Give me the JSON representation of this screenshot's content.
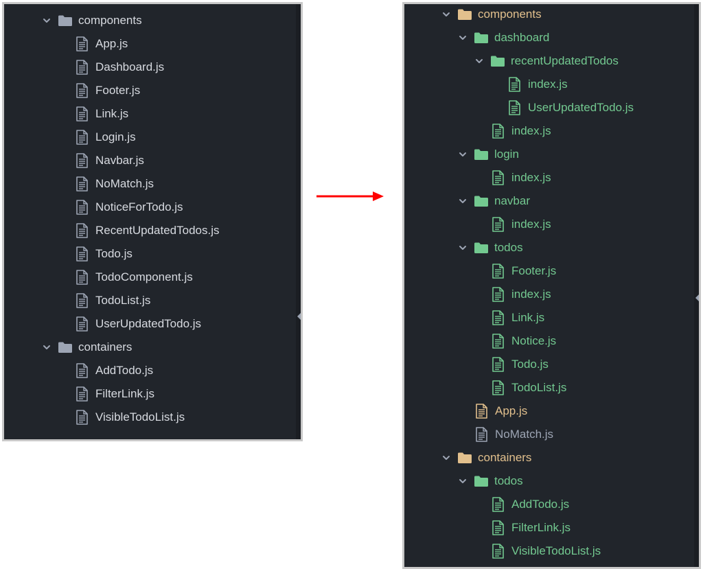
{
  "left_tree": {
    "rows": [
      {
        "label": "components",
        "kind": "folder",
        "expanded": true,
        "depth": 0,
        "color": "white"
      },
      {
        "label": "App.js",
        "kind": "file",
        "depth": 1,
        "color": "white"
      },
      {
        "label": "Dashboard.js",
        "kind": "file",
        "depth": 1,
        "color": "white"
      },
      {
        "label": "Footer.js",
        "kind": "file",
        "depth": 1,
        "color": "white"
      },
      {
        "label": "Link.js",
        "kind": "file",
        "depth": 1,
        "color": "white"
      },
      {
        "label": "Login.js",
        "kind": "file",
        "depth": 1,
        "color": "white"
      },
      {
        "label": "Navbar.js",
        "kind": "file",
        "depth": 1,
        "color": "white"
      },
      {
        "label": "NoMatch.js",
        "kind": "file",
        "depth": 1,
        "color": "white"
      },
      {
        "label": "NoticeForTodo.js",
        "kind": "file",
        "depth": 1,
        "color": "white"
      },
      {
        "label": "RecentUpdatedTodos.js",
        "kind": "file",
        "depth": 1,
        "color": "white"
      },
      {
        "label": "Todo.js",
        "kind": "file",
        "depth": 1,
        "color": "white"
      },
      {
        "label": "TodoComponent.js",
        "kind": "file",
        "depth": 1,
        "color": "white"
      },
      {
        "label": "TodoList.js",
        "kind": "file",
        "depth": 1,
        "color": "white"
      },
      {
        "label": "UserUpdatedTodo.js",
        "kind": "file",
        "depth": 1,
        "color": "white"
      },
      {
        "label": "containers",
        "kind": "folder",
        "expanded": true,
        "depth": 0,
        "color": "white"
      },
      {
        "label": "AddTodo.js",
        "kind": "file",
        "depth": 1,
        "color": "white"
      },
      {
        "label": "FilterLink.js",
        "kind": "file",
        "depth": 1,
        "color": "white"
      },
      {
        "label": "VisibleTodoList.js",
        "kind": "file",
        "depth": 1,
        "color": "white"
      }
    ]
  },
  "right_tree": {
    "rows": [
      {
        "label": "components",
        "kind": "folder",
        "expanded": true,
        "depth": 0,
        "color": "yellow"
      },
      {
        "label": "dashboard",
        "kind": "folder",
        "expanded": true,
        "depth": 1,
        "color": "green"
      },
      {
        "label": "recentUpdatedTodos",
        "kind": "folder",
        "expanded": true,
        "depth": 2,
        "color": "green"
      },
      {
        "label": "index.js",
        "kind": "file",
        "depth": 3,
        "color": "green"
      },
      {
        "label": "UserUpdatedTodo.js",
        "kind": "file",
        "depth": 3,
        "color": "green"
      },
      {
        "label": "index.js",
        "kind": "file",
        "depth": 2,
        "color": "green"
      },
      {
        "label": "login",
        "kind": "folder",
        "expanded": true,
        "depth": 1,
        "color": "green"
      },
      {
        "label": "index.js",
        "kind": "file",
        "depth": 2,
        "color": "green"
      },
      {
        "label": "navbar",
        "kind": "folder",
        "expanded": true,
        "depth": 1,
        "color": "green"
      },
      {
        "label": "index.js",
        "kind": "file",
        "depth": 2,
        "color": "green"
      },
      {
        "label": "todos",
        "kind": "folder",
        "expanded": true,
        "depth": 1,
        "color": "green"
      },
      {
        "label": "Footer.js",
        "kind": "file",
        "depth": 2,
        "color": "green"
      },
      {
        "label": "index.js",
        "kind": "file",
        "depth": 2,
        "color": "green"
      },
      {
        "label": "Link.js",
        "kind": "file",
        "depth": 2,
        "color": "green"
      },
      {
        "label": "Notice.js",
        "kind": "file",
        "depth": 2,
        "color": "green"
      },
      {
        "label": "Todo.js",
        "kind": "file",
        "depth": 2,
        "color": "green"
      },
      {
        "label": "TodoList.js",
        "kind": "file",
        "depth": 2,
        "color": "green"
      },
      {
        "label": "App.js",
        "kind": "file",
        "depth": 1,
        "color": "yellow"
      },
      {
        "label": "NoMatch.js",
        "kind": "file",
        "depth": 1,
        "color": "gray"
      },
      {
        "label": "containers",
        "kind": "folder",
        "expanded": true,
        "depth": 0,
        "color": "yellow"
      },
      {
        "label": "todos",
        "kind": "folder",
        "expanded": true,
        "depth": 1,
        "color": "green"
      },
      {
        "label": "AddTodo.js",
        "kind": "file",
        "depth": 2,
        "color": "green"
      },
      {
        "label": "FilterLink.js",
        "kind": "file",
        "depth": 2,
        "color": "green"
      },
      {
        "label": "VisibleTodoList.js",
        "kind": "file",
        "depth": 2,
        "color": "green"
      }
    ]
  },
  "colors": {
    "panel_bg": "#21252b",
    "text_default": "#d7dae0",
    "text_dim": "#9da5b4",
    "vcs_added": "#73c990",
    "vcs_modified": "#e2c08d",
    "arrow": "#ff0000"
  },
  "icons": {
    "folder": "folder-icon",
    "file": "file-text-icon",
    "chevron": "chevron-down-icon",
    "arrow": "arrow-right-icon"
  }
}
